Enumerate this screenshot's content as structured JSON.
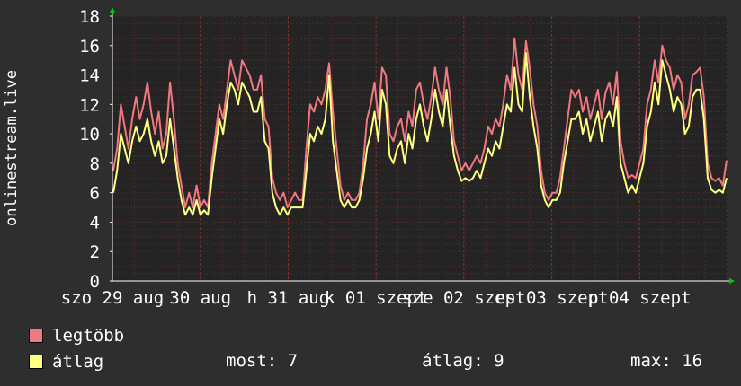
{
  "colors": {
    "background": "#2e2e2e",
    "plot_bg": "#242424",
    "grid": "#6a2e2e",
    "grid_major": "#8a3030",
    "legtobb": "#f07880",
    "atlag": "#ffff80",
    "arrow": "#00cc00"
  },
  "legend": {
    "max_label": "legtöbb",
    "avg_label": "átlag"
  },
  "stats": {
    "now": "most: 7",
    "avg": "átlag: 9",
    "max": "max: 16"
  },
  "chart_data": {
    "type": "line",
    "ylabel": "onlinestream.live",
    "ylim": [
      0,
      18
    ],
    "yticks": [
      0,
      2,
      4,
      6,
      8,
      10,
      12,
      14,
      16,
      18
    ],
    "xtick_labels": [
      "szo 29 aug",
      "30 aug",
      "h 31 aug",
      "k 01 szept",
      "sze 02 szept",
      "cs 03 szept",
      "p 04 szept"
    ],
    "grid": true,
    "series": [
      {
        "name": "legtöbb",
        "values": [
          7.5,
          9,
          12,
          10.5,
          9,
          11,
          12.5,
          11,
          12,
          13.5,
          11.5,
          10,
          11.5,
          9,
          10,
          13.5,
          11,
          8,
          6.5,
          5,
          6,
          5,
          6.5,
          5,
          5.5,
          5,
          8,
          10,
          12,
          11,
          13,
          15,
          14,
          13,
          15,
          14.5,
          14,
          13,
          13,
          14,
          11,
          10.5,
          7,
          6,
          5.5,
          6,
          5,
          5.5,
          6,
          5.5,
          5.5,
          9,
          12,
          11.5,
          12.5,
          12,
          13,
          14.8,
          11.5,
          9,
          6.5,
          5.5,
          6,
          5.5,
          5.5,
          6,
          8,
          11,
          12,
          13.5,
          11,
          14.5,
          14,
          10,
          9.5,
          10.5,
          11,
          9.5,
          11.5,
          10.5,
          13,
          13.5,
          12,
          11,
          12.5,
          14.5,
          13,
          12,
          14.5,
          12.5,
          9.5,
          8.5,
          7.5,
          8,
          7.5,
          8,
          8.5,
          8,
          9,
          10.5,
          10,
          11,
          10.5,
          12,
          14,
          13,
          16.5,
          14,
          13,
          16.3,
          14.5,
          12,
          10.5,
          7.5,
          6,
          5.5,
          6,
          6,
          7,
          9,
          11,
          13,
          12.5,
          13,
          11.5,
          12.5,
          11,
          12,
          13,
          11,
          12.8,
          13.5,
          12,
          14.2,
          9.5,
          8,
          7,
          7.2,
          7,
          8,
          9,
          12,
          13,
          15,
          13.5,
          16,
          15,
          14.5,
          13,
          14,
          13.5,
          11,
          12,
          14,
          14.2,
          14.5,
          12.5,
          8,
          7,
          6.8,
          7,
          6.5,
          8.2
        ]
      },
      {
        "name": "átlag",
        "values": [
          6,
          7.5,
          10,
          9,
          8,
          9.5,
          10.5,
          9.5,
          10,
          11,
          9.5,
          8.5,
          9.5,
          8,
          8.5,
          11,
          9,
          7,
          5.5,
          4.5,
          5,
          4.5,
          5.5,
          4.5,
          4.8,
          4.5,
          7,
          9,
          11,
          10,
          12,
          13.5,
          13,
          12,
          13.5,
          13,
          12.5,
          11.5,
          11.5,
          12.5,
          9.5,
          9,
          6,
          5,
          4.5,
          5,
          4.5,
          5,
          5,
          5,
          5,
          7.5,
          10,
          9.5,
          10.5,
          10,
          11,
          14,
          9.5,
          7.5,
          5.5,
          5,
          5.5,
          5,
          5,
          5.5,
          7,
          9,
          10,
          11.5,
          9.5,
          13,
          12,
          8.5,
          8,
          9,
          9.5,
          8,
          10,
          9,
          11,
          12,
          10.5,
          9.5,
          11,
          13,
          11.5,
          10.5,
          13,
          10.5,
          8.5,
          7.5,
          6.8,
          7,
          6.8,
          7,
          7.5,
          7,
          8,
          9,
          8.5,
          9.5,
          9,
          10.5,
          12,
          11.5,
          14.5,
          12,
          11.5,
          15.5,
          12.5,
          10.5,
          9,
          6.5,
          5.5,
          5,
          5.5,
          5.5,
          6,
          8,
          9.5,
          11,
          11,
          11.5,
          10,
          11,
          9.5,
          10.5,
          11.5,
          9.5,
          11,
          11.5,
          10.5,
          12.5,
          8,
          7,
          6,
          6.5,
          6,
          7,
          8,
          10.5,
          11.5,
          13.5,
          12,
          15,
          14,
          13,
          11.5,
          12.5,
          12,
          10,
          10.5,
          12.5,
          13,
          13,
          11,
          7,
          6.2,
          6,
          6.2,
          6,
          7
        ]
      }
    ]
  }
}
